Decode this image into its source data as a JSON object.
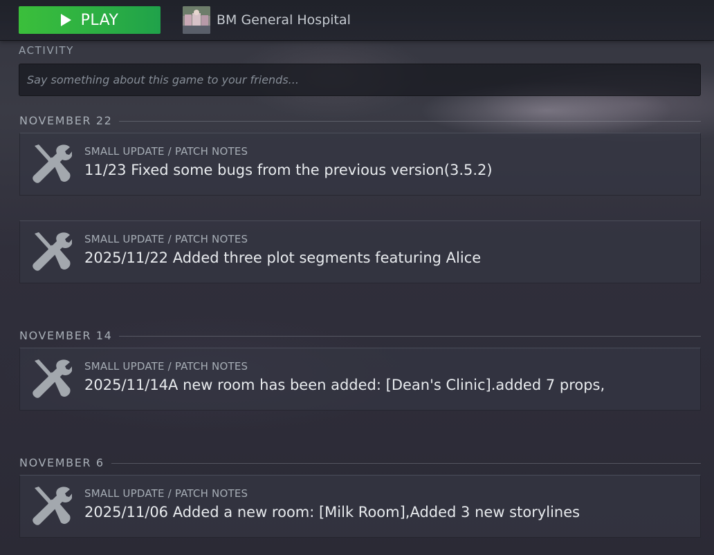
{
  "header": {
    "play_label": "PLAY",
    "game_title": "BM General Hospital"
  },
  "activity": {
    "section_label": "ACTIVITY",
    "input_placeholder": "Say something about this game to your friends..."
  },
  "groups": [
    {
      "date": "NOVEMBER 22",
      "events": [
        {
          "type": "SMALL UPDATE / PATCH NOTES",
          "title": "11/23 Fixed some bugs from the previous version(3.5.2)",
          "icon": "tools-icon"
        },
        {
          "type": "SMALL UPDATE / PATCH NOTES",
          "title": "2025/11/22 Added three plot segments featuring Alice",
          "icon": "tools-icon"
        }
      ]
    },
    {
      "date": "NOVEMBER 14",
      "events": [
        {
          "type": "SMALL UPDATE / PATCH NOTES",
          "title": "2025/11/14A new room has been added: [Dean's Clinic].added 7 props,",
          "icon": "tools-icon"
        }
      ]
    },
    {
      "date": "NOVEMBER 6",
      "events": [
        {
          "type": "SMALL UPDATE / PATCH NOTES",
          "title": "2025/11/06 Added a new room: [Milk Room],Added 3 new storylines",
          "icon": "tools-icon"
        }
      ]
    }
  ],
  "colors": {
    "play_button": "#2bb343",
    "icon_gray": "#a3a8ae"
  }
}
